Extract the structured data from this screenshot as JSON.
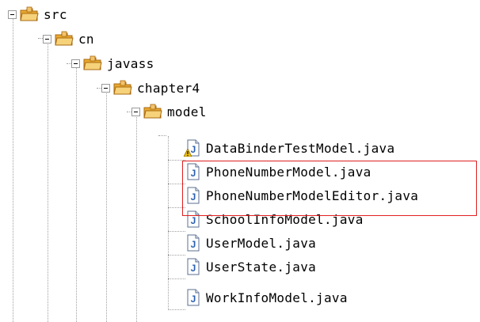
{
  "tree": {
    "folders": [
      {
        "label": "src"
      },
      {
        "label": "cn"
      },
      {
        "label": "javass"
      },
      {
        "label": "chapter4"
      },
      {
        "label": "model"
      }
    ],
    "files": [
      {
        "label": "DataBinderTestModel.java",
        "warning": true
      },
      {
        "label": "PhoneNumberModel.java",
        "warning": false
      },
      {
        "label": "PhoneNumberModelEditor.java",
        "warning": false
      },
      {
        "label": "SchoolInfoModel.java",
        "warning": false
      },
      {
        "label": "UserModel.java",
        "warning": false
      },
      {
        "label": "UserState.java",
        "warning": false
      },
      {
        "label": "WorkInfoModel.java",
        "warning": false
      }
    ],
    "highlighted_files": [
      "PhoneNumberModel.java",
      "PhoneNumberModelEditor.java"
    ]
  },
  "colors": {
    "folder": "#e8a830",
    "java_icon": "#2a5fb0",
    "highlight": "#e02020",
    "warning": "#f0c000"
  },
  "icons": {
    "folder": "package-folder-icon",
    "java": "java-file-icon",
    "expander": "collapse-toggle-icon"
  }
}
